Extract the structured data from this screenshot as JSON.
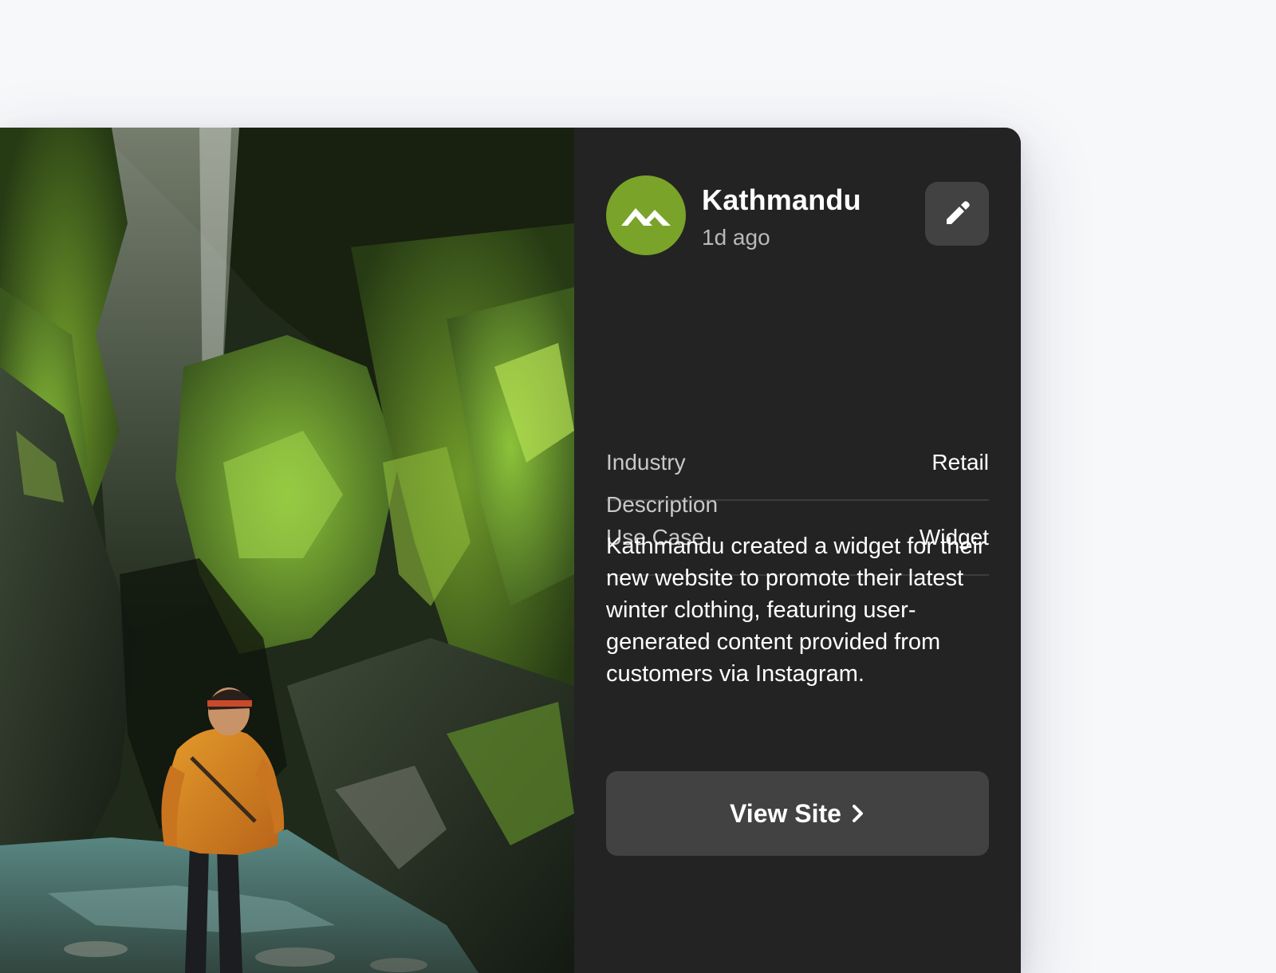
{
  "brand": {
    "name": "Kathmandu",
    "timestamp": "1d ago",
    "logo_icon": "mountain-logo-icon",
    "color": "#7aa329"
  },
  "actions": {
    "edit_icon": "pencil-icon"
  },
  "details": [
    {
      "label": "Industry",
      "value": "Retail"
    },
    {
      "label": "Use Case",
      "value": "Widget"
    }
  ],
  "description": {
    "label": "Description",
    "text": "Kathmandu created a widget for their new website to promote their latest winter clothing, featuring user-generated content provided from customers via Instagram."
  },
  "cta": {
    "label": "View Site",
    "icon": "chevron-right-icon"
  },
  "colors": {
    "panel_bg": "#232323",
    "button_bg": "#424242",
    "page_bg": "#f7f8fa"
  }
}
